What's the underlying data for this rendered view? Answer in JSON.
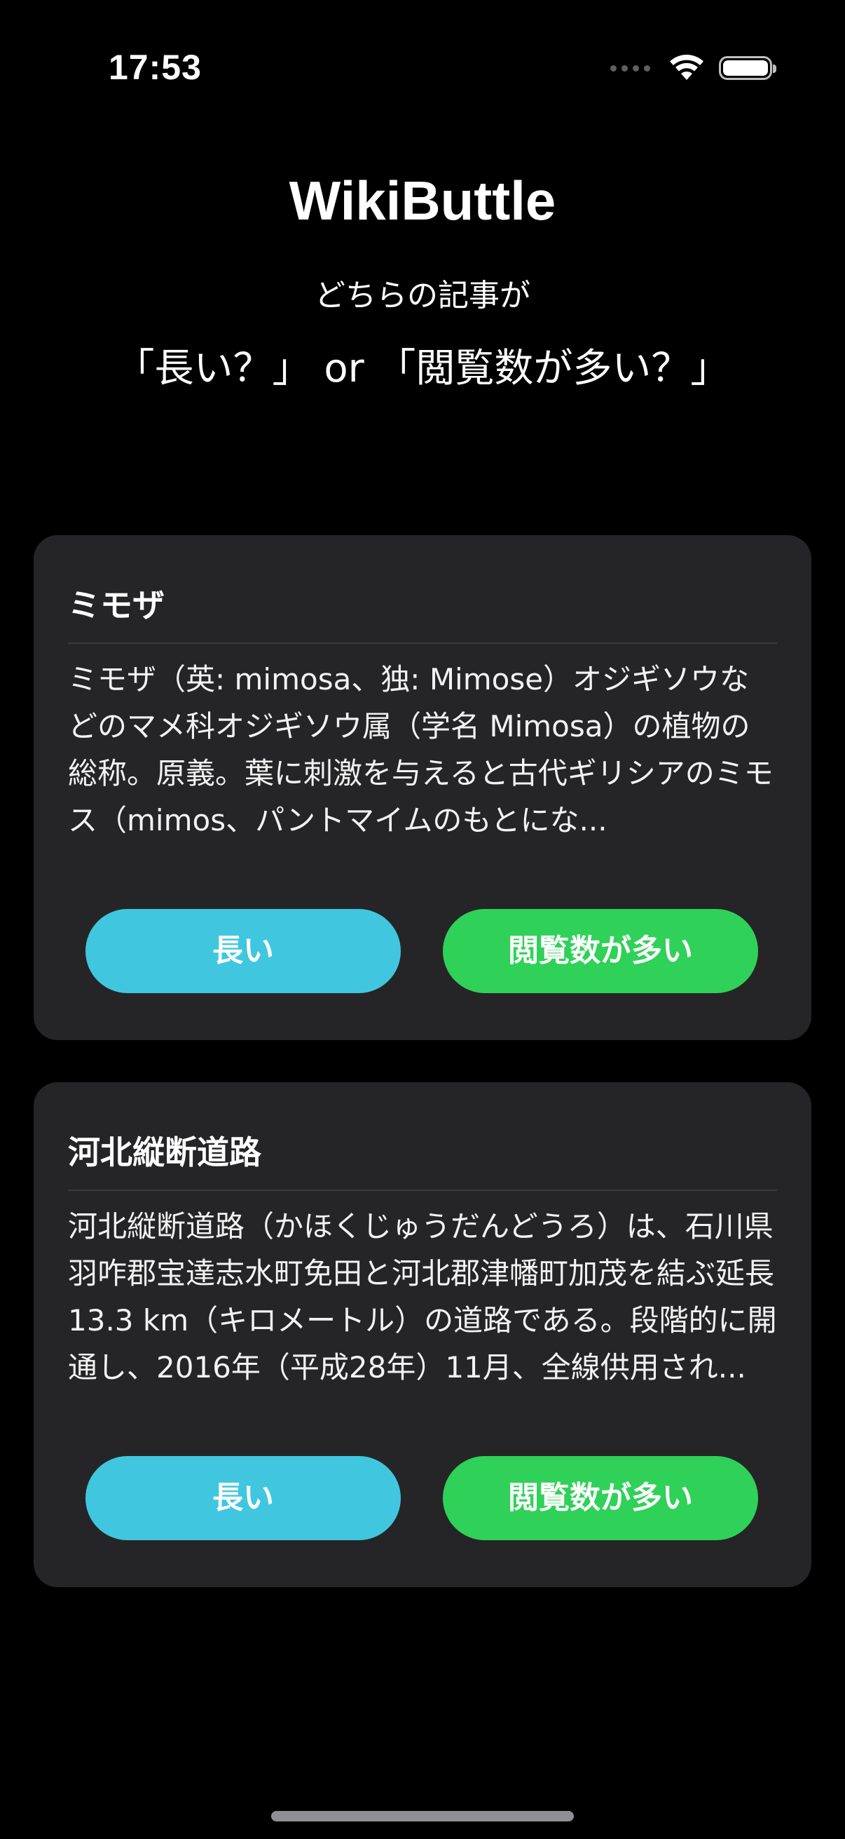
{
  "status_bar": {
    "time": "17:53"
  },
  "header": {
    "title": "WikiButtle",
    "subtitle": "どちらの記事が",
    "question": "「長い？」 or 「閲覧数が多い？」"
  },
  "articles": [
    {
      "title": "ミモザ",
      "excerpt": "ミモザ（英: mimosa、独: Mimose）オジギソウなどのマメ科オジギソウ属（学名 Mimosa）の植物の総称。原義。葉に刺激を与えると古代ギリシアのミモス（mimos、パントマイムのもとにな...",
      "long_label": "長い",
      "views_label": "閲覧数が多い"
    },
    {
      "title": "河北縦断道路",
      "excerpt": "河北縦断道路（かほくじゅうだんどうろ）は、石川県羽咋郡宝達志水町免田と河北郡津幡町加茂を結ぶ延長13.3 km（キロメートル）の道路である。段階的に開通し、2016年（平成28年）11月、全線供用され...",
      "long_label": "長い",
      "views_label": "閲覧数が多い"
    }
  ],
  "colors": {
    "background": "#000000",
    "card": "#252527",
    "long_button": "#40c7df",
    "views_button": "#2fd158"
  }
}
